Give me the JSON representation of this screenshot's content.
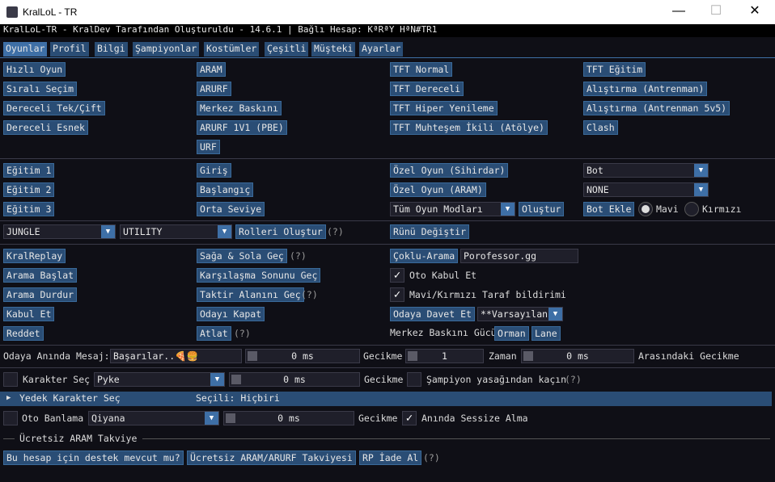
{
  "window": {
    "icon": "app-icon",
    "title": "KralLoL - TR",
    "min": "—",
    "max": "☐",
    "close": "✕"
  },
  "menubar": {
    "text": "KralLoL-TR - KralDev Tarafından Oluşturuldu - 14.6.1 | Bağlı Hesap: KªRªY HªN#TR1"
  },
  "tabs": [
    "Oyunlar",
    "Profil",
    "Bilgi",
    "Şampiyonlar",
    "Kostümler",
    "Çeşitli",
    "Müşteki",
    "Ayarlar"
  ],
  "games": {
    "col1": [
      "Hızlı Oyun",
      "Sıralı Seçim",
      "Dereceli Tek/Çift",
      "Dereceli Esnek"
    ],
    "col2": [
      "ARAM",
      "ARURF",
      "Merkez Baskını",
      "ARURF 1V1 (PBE)",
      "URF"
    ],
    "col3": [
      "TFT Normal",
      "TFT Dereceli",
      "TFT Hiper Yenileme",
      "TFT Muhteşem İkili (Atölye)"
    ],
    "col4": [
      "TFT Eğitim",
      "Alıştırma (Antrenman)",
      "Alıştırma (Antrenman 5v5)",
      "Clash"
    ]
  },
  "training": {
    "col1": [
      "Eğitim 1",
      "Eğitim 2",
      "Eğitim 3"
    ],
    "col2": [
      "Giriş",
      "Başlangıç",
      "Orta Seviye"
    ],
    "col3": [
      "Özel Oyun (Sihirdar)",
      "Özel Oyun (ARAM)"
    ],
    "mode_select": "Tüm Oyun Modları",
    "create": "Oluştur",
    "bot_select": "Bot",
    "none_select": "NONE",
    "bot_add": "Bot Ekle",
    "blue": "Mavi",
    "red": "Kırmızı"
  },
  "roles": {
    "role1": "JUNGLE",
    "role2": "UTILITY",
    "create": "Rolleri Oluştur",
    "help": "(?)",
    "rune": "Rünü Değiştir"
  },
  "misc": {
    "col1": [
      "KralReplay",
      "Arama Başlat",
      "Arama Durdur",
      "Kabul Et",
      "Reddet"
    ],
    "col2": [
      "Sağa & Sola Geç",
      "Karşılaşma Sonunu Geç",
      "Taktir Alanını Geç",
      "Odayı Kapat",
      "Atlat"
    ],
    "col2_help": "(?)",
    "multisearch": "Çoklu-Arama",
    "multisearch_value": "Porofessor.gg",
    "auto_accept": "Oto Kabul Et",
    "side_notify": "Mavi/Kırmızı Taraf bildirimi",
    "invite": "Odaya Davet Et",
    "invite_select": "**Varsayılan",
    "nexus_label": "Merkez Baskını Gücü",
    "orman": "Orman",
    "lane": "Lane"
  },
  "message_row": {
    "label": "Odaya Anında Mesaj:",
    "value": "Başarılar..🍕🍔",
    "delay1": "0 ms",
    "delay_label": "Gecikme",
    "count": "1",
    "time_label": "Zaman",
    "delay2": "0 ms",
    "between_label": "Arasındaki Gecikme"
  },
  "champ_row": {
    "label": "Karakter Seç",
    "champ": "Pyke",
    "delay": "0 ms",
    "delay_label": "Gecikme",
    "avoid": "Şampiyon yasağından kaçın",
    "help": "(?)"
  },
  "backup": {
    "label": "Yedek Karakter Seç",
    "selected": "Seçili: Hiçbiri"
  },
  "ban_row": {
    "label": "Oto Banlama",
    "champ": "Qiyana",
    "delay": "0 ms",
    "delay_label": "Gecikme",
    "mute": "Anında Sessize Alma"
  },
  "aram": {
    "header": "Ücretsiz ARAM Takviye",
    "check": "Bu hesap için destek mevcut mu?",
    "boost": "Ücretsiz ARAM/ARURF Takviyesi",
    "refund": "RP İade Al",
    "help": "(?)"
  },
  "colors": {
    "button": "#2a4d75",
    "active_tab": "#3e6fa6",
    "background": "#0f0f16"
  }
}
